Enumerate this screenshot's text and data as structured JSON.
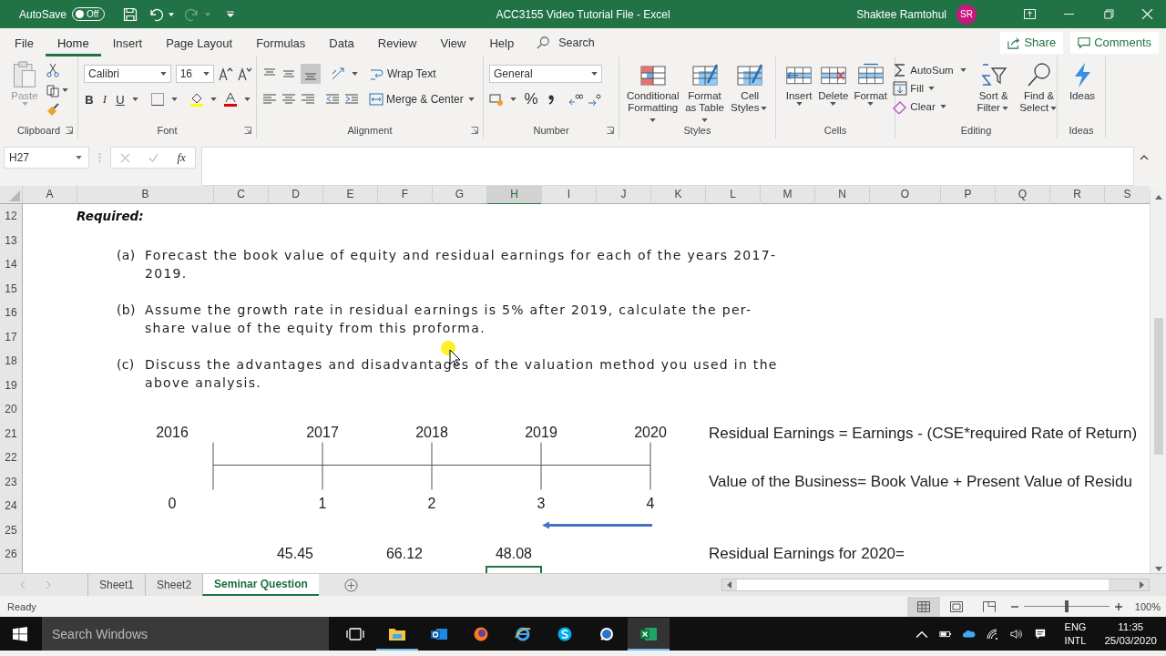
{
  "title_bar": {
    "autosave_label": "AutoSave",
    "autosave": {
      "label": "Off",
      "on": false
    },
    "title": "ACC3155 Video Tutorial File  -  Excel",
    "user": "Shaktee Ramtohul",
    "avatar": "SR"
  },
  "menu_tabs": [
    {
      "label": "File",
      "selected": false
    },
    {
      "label": "Home",
      "selected": true
    },
    {
      "label": "Insert",
      "selected": false
    },
    {
      "label": "Page Layout",
      "selected": false
    },
    {
      "label": "Formulas",
      "selected": false
    },
    {
      "label": "Data",
      "selected": false
    },
    {
      "label": "Review",
      "selected": false
    },
    {
      "label": "View",
      "selected": false
    },
    {
      "label": "Help",
      "selected": false
    }
  ],
  "search": {
    "placeholder": "Search"
  },
  "share": "Share",
  "comments": "Comments",
  "ribbon": {
    "clipboard": {
      "title": "Clipboard",
      "paste": "Paste"
    },
    "font": {
      "title": "Font",
      "family": "Calibri",
      "size": "16",
      "bold": "B",
      "italic": "I",
      "underline": "U"
    },
    "alignment": {
      "title": "Alignment",
      "wrap_text": "Wrap Text",
      "merge": "Merge & Center"
    },
    "number": {
      "title": "Number",
      "format": "General",
      "percent": "%"
    },
    "styles": {
      "title": "Styles",
      "buttons": [
        "Conditional Formatting",
        "Format as Table",
        "Cell Styles"
      ]
    },
    "cells": {
      "title": "Cells",
      "buttons": [
        "Insert",
        "Delete",
        "Format"
      ]
    },
    "editing": {
      "title": "Editing",
      "autosum": "AutoSum",
      "fill": "Fill",
      "clear": "Clear",
      "sort": "Sort & Filter",
      "find": "Find & Select"
    },
    "ideas": {
      "title": "Ideas",
      "button": "Ideas"
    }
  },
  "formula_bar": {
    "name_box": "H27",
    "function_label": "fx"
  },
  "columns": [
    {
      "label": "A",
      "selected": false
    },
    {
      "label": "B",
      "selected": false
    },
    {
      "label": "C",
      "selected": false
    },
    {
      "label": "D",
      "selected": false
    },
    {
      "label": "E",
      "selected": false
    },
    {
      "label": "F",
      "selected": false
    },
    {
      "label": "G",
      "selected": false
    },
    {
      "label": "H",
      "selected": true
    },
    {
      "label": "I",
      "selected": false
    },
    {
      "label": "J",
      "selected": false
    },
    {
      "label": "K",
      "selected": false
    },
    {
      "label": "L",
      "selected": false
    },
    {
      "label": "M",
      "selected": false
    },
    {
      "label": "N",
      "selected": false
    },
    {
      "label": "O",
      "selected": false
    },
    {
      "label": "P",
      "selected": false
    },
    {
      "label": "Q",
      "selected": false
    },
    {
      "label": "R",
      "selected": false
    },
    {
      "label": "S",
      "selected": false
    }
  ],
  "rows": [
    "12",
    "13",
    "14",
    "15",
    "16",
    "17",
    "18",
    "19",
    "20",
    "21",
    "22",
    "23",
    "24",
    "25",
    "26"
  ],
  "sheet": {
    "required": "Required:",
    "questions": [
      {
        "label": "(a)",
        "text": "Forecast the book value of equity and residual earnings for each of the years 2017-2019."
      },
      {
        "label": "(b)",
        "text": "Assume the growth rate in residual earnings is 5% after 2019, calculate the per-share value of the equity from this proforma."
      },
      {
        "label": "(c)",
        "text": "Discuss the advantages and disadvantages of the valuation method you used in the above analysis."
      }
    ],
    "years": [
      "2016",
      "2017",
      "2018",
      "2019",
      "2020"
    ],
    "periods": [
      "0",
      "1",
      "2",
      "3",
      "4"
    ],
    "values": [
      "45.45",
      "66.12",
      "48.08"
    ],
    "formulas": [
      "Residual Earnings = Earnings - (CSE*required Rate of Return)",
      "Value of the Business=  Book Value + Present Value of Residu",
      "Residual Earnings for 2020="
    ]
  },
  "sheet_tabs": [
    {
      "label": "Sheet1",
      "selected": false
    },
    {
      "label": "Sheet2",
      "selected": false
    },
    {
      "label": "Seminar Question",
      "selected": true
    }
  ],
  "status": "Ready",
  "zoom": {
    "label": "100%",
    "level": 0.5
  },
  "taskbar": {
    "search_placeholder": "Search Windows",
    "language": [
      "ENG",
      "INTL"
    ],
    "time": "11:35",
    "date": "25/03/2020"
  }
}
